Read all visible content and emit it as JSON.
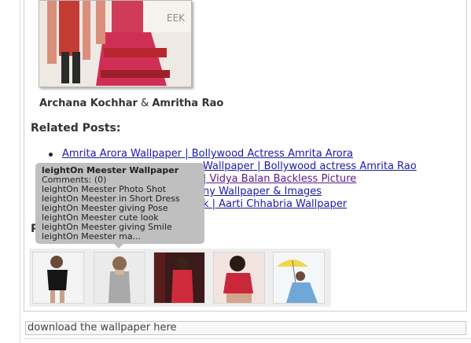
{
  "gallery": {
    "caption_name_1": "Archana Kochhar",
    "caption_sep": "&",
    "caption_name_2": "Amritha Rao"
  },
  "related": {
    "heading": "Related Posts:",
    "items": [
      {
        "label": "Amrita Arora Wallpaper | Bollywood Actress Amrita Arora"
      },
      {
        "label": "Wallpaper | Bollywood actress Amrita Rao"
      },
      {
        "label": "| Vidya Balan Backless Picture"
      },
      {
        "label": "ny Wallpaper & Images"
      },
      {
        "label": "k | Aarti Chhabria Wallpaper"
      }
    ]
  },
  "popular": {
    "heading_visible": "P"
  },
  "tooltip": {
    "title": "leightOn Meester Wallpaper",
    "lines": [
      "Comments: (0)",
      "leightOn Meester Photo Shot",
      "leightOn Meester in Short Dress",
      "leightOn Meester giving Pose",
      "leightOn Meester cute look",
      "leightOn Meester giving Smile",
      "leightOn Meester ma..."
    ]
  },
  "thumbnails": [
    {
      "icon": "photo-icon"
    },
    {
      "icon": "photo-icon"
    },
    {
      "icon": "photo-icon"
    },
    {
      "icon": "photo-icon"
    },
    {
      "icon": "photo-icon"
    }
  ],
  "download": {
    "text": "download the wallpaper here"
  }
}
